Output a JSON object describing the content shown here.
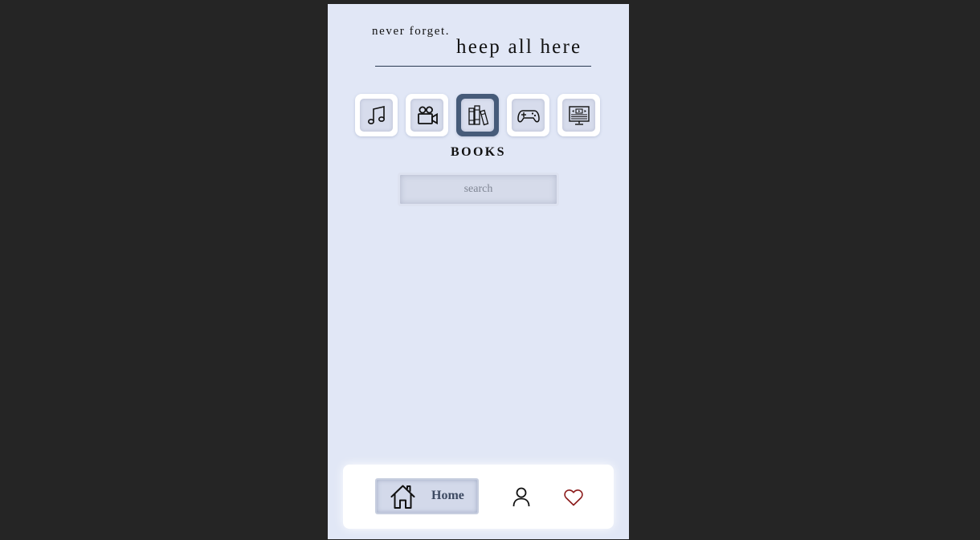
{
  "header": {
    "tagline": "never forget.",
    "headline": "heep all here"
  },
  "categories": [
    {
      "name": "music",
      "icon": "music-note-icon",
      "active": false
    },
    {
      "name": "movies",
      "icon": "video-camera-icon",
      "active": false
    },
    {
      "name": "books",
      "icon": "books-icon",
      "active": true
    },
    {
      "name": "games",
      "icon": "gamepad-icon",
      "active": false
    },
    {
      "name": "tv",
      "icon": "monitor-icon",
      "active": false
    }
  ],
  "current_category": "BOOKS",
  "search": {
    "placeholder": "search",
    "value": ""
  },
  "nav": {
    "home_label": "Home",
    "home_icon": "home-icon",
    "profile_icon": "user-icon",
    "favorites_icon": "heart-icon"
  },
  "colors": {
    "background": "#e1e7f6",
    "active_accent": "#465b79",
    "heart": "#8b1a1a"
  }
}
